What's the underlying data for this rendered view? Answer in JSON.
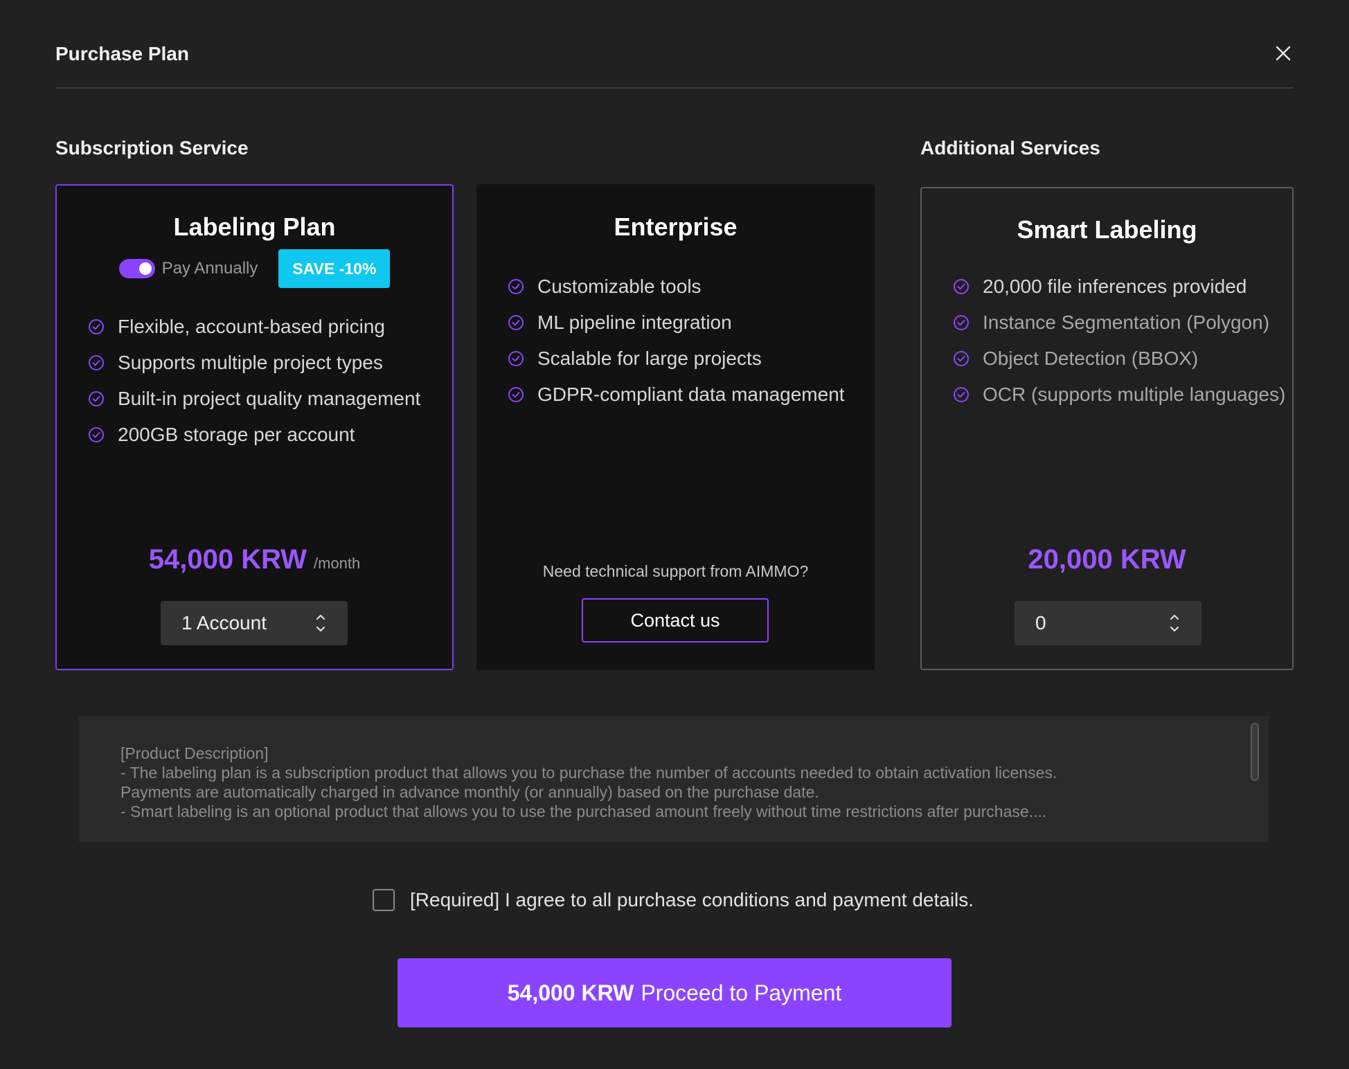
{
  "modal": {
    "title": "Purchase Plan"
  },
  "sections": {
    "subscription": "Subscription Service",
    "additional": "Additional Services"
  },
  "labeling_plan": {
    "name": "Labeling Plan",
    "toggle_label": "Pay Annually",
    "toggle_on": true,
    "save_badge": "SAVE -10%",
    "features": [
      "Flexible, account-based pricing",
      "Supports multiple project types",
      "Built-in project quality management",
      "200GB storage per account"
    ],
    "price": "54,000 KRW",
    "price_unit": "/month",
    "stepper_value": "1 Account"
  },
  "enterprise": {
    "name": "Enterprise",
    "features": [
      "Customizable tools",
      "ML pipeline integration",
      "Scalable for large projects",
      "GDPR-compliant data management"
    ],
    "support_text": "Need technical support from AIMMO?",
    "contact_label": "Contact us"
  },
  "smart_labeling": {
    "name": "Smart Labeling",
    "features": [
      "20,000 file inferences provided",
      "Instance Segmentation (Polygon)",
      "Object Detection (BBOX)",
      "OCR (supports multiple languages)"
    ],
    "price": "20,000 KRW",
    "stepper_value": "0"
  },
  "description": {
    "lines": [
      "[Product Description]",
      "- The labeling plan is a subscription product that allows you to purchase the number of accounts needed to obtain activation licenses.",
      "Payments are automatically charged in advance monthly (or annually) based on the purchase date.",
      "- Smart labeling is an optional product that allows you to use the purchased amount freely without time restrictions after purchase...."
    ]
  },
  "agreement": {
    "text": "[Required] I agree to all purchase conditions and payment details.",
    "checked": false
  },
  "payment": {
    "amount": "54,000 KRW",
    "label": "Proceed to Payment"
  },
  "colors": {
    "accent": "#8a44ff",
    "badge": "#10c8ef",
    "price": "#9b57ff",
    "background": "#212121",
    "card": "#121212"
  },
  "icons": {
    "close": "close-icon",
    "check": "check-circle-icon",
    "stepper": "chevron-up-down-icon"
  }
}
